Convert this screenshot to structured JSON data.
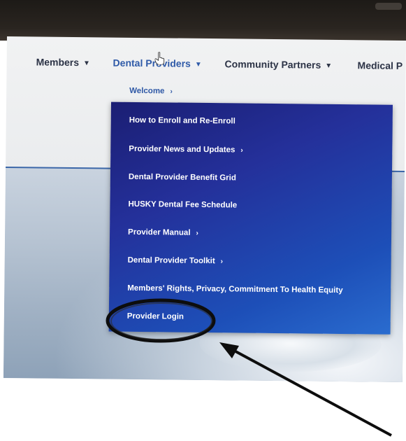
{
  "nav": {
    "items": [
      {
        "label": "Members",
        "caret": "▼"
      },
      {
        "label": "Dental Providers",
        "caret": "▼"
      },
      {
        "label": "Community Partners",
        "caret": "▼"
      },
      {
        "label": "Medical P"
      }
    ]
  },
  "submenu": {
    "welcome": {
      "label": "Welcome",
      "chevron": "›"
    }
  },
  "dropdown": {
    "items": [
      {
        "label": "How to Enroll and Re-Enroll"
      },
      {
        "label": "Provider News and Updates",
        "chevron": "›"
      },
      {
        "label": "Dental Provider Benefit Grid"
      },
      {
        "label": "HUSKY Dental Fee Schedule"
      },
      {
        "label": "Provider Manual",
        "chevron": "›"
      },
      {
        "label": "Dental Provider Toolkit",
        "chevron": "›"
      },
      {
        "label": "Members' Rights, Privacy, Commitment To Health Equity"
      },
      {
        "label": "Provider Login"
      }
    ]
  },
  "colors": {
    "menu_bg_dark": "#1b1e73",
    "menu_bg_light": "#2a6ccf",
    "nav_text": "#2c3346",
    "nav_active": "#2f5aa8",
    "annotation": "#0d0d0d"
  },
  "annotation": {
    "highlighted_item": "Provider Login",
    "icons": [
      "arrow-icon",
      "circle-highlight"
    ]
  }
}
